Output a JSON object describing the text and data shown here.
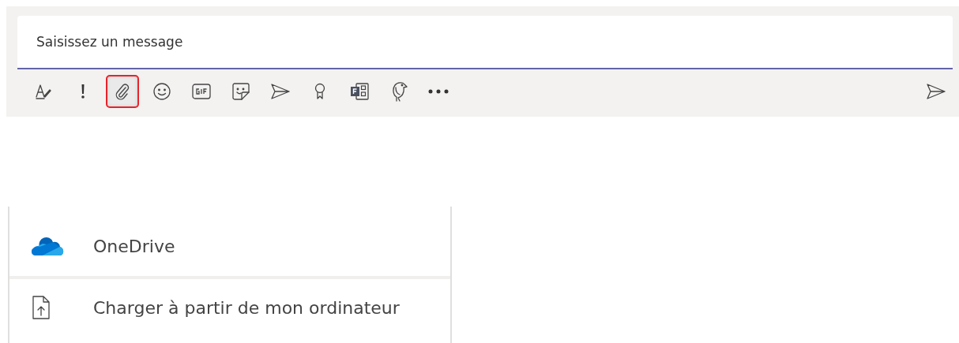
{
  "compose": {
    "placeholder": "Saisissez un message"
  },
  "toolbar": [
    {
      "kind": "format",
      "selected": false
    },
    {
      "kind": "important",
      "selected": false
    },
    {
      "kind": "attach",
      "selected": true
    },
    {
      "kind": "emoji",
      "selected": false
    },
    {
      "kind": "gif",
      "selected": false
    },
    {
      "kind": "sticker",
      "selected": false
    },
    {
      "kind": "meet",
      "selected": false
    },
    {
      "kind": "praise",
      "selected": false
    },
    {
      "kind": "forms",
      "selected": false
    },
    {
      "kind": "bird",
      "selected": false
    },
    {
      "kind": "more",
      "selected": false
    }
  ],
  "send": {
    "kind": "send"
  },
  "attach_menu": [
    {
      "kind": "onedrive",
      "label": "OneDrive"
    },
    {
      "kind": "upload",
      "label": "Charger à partir de mon ordinateur"
    }
  ]
}
